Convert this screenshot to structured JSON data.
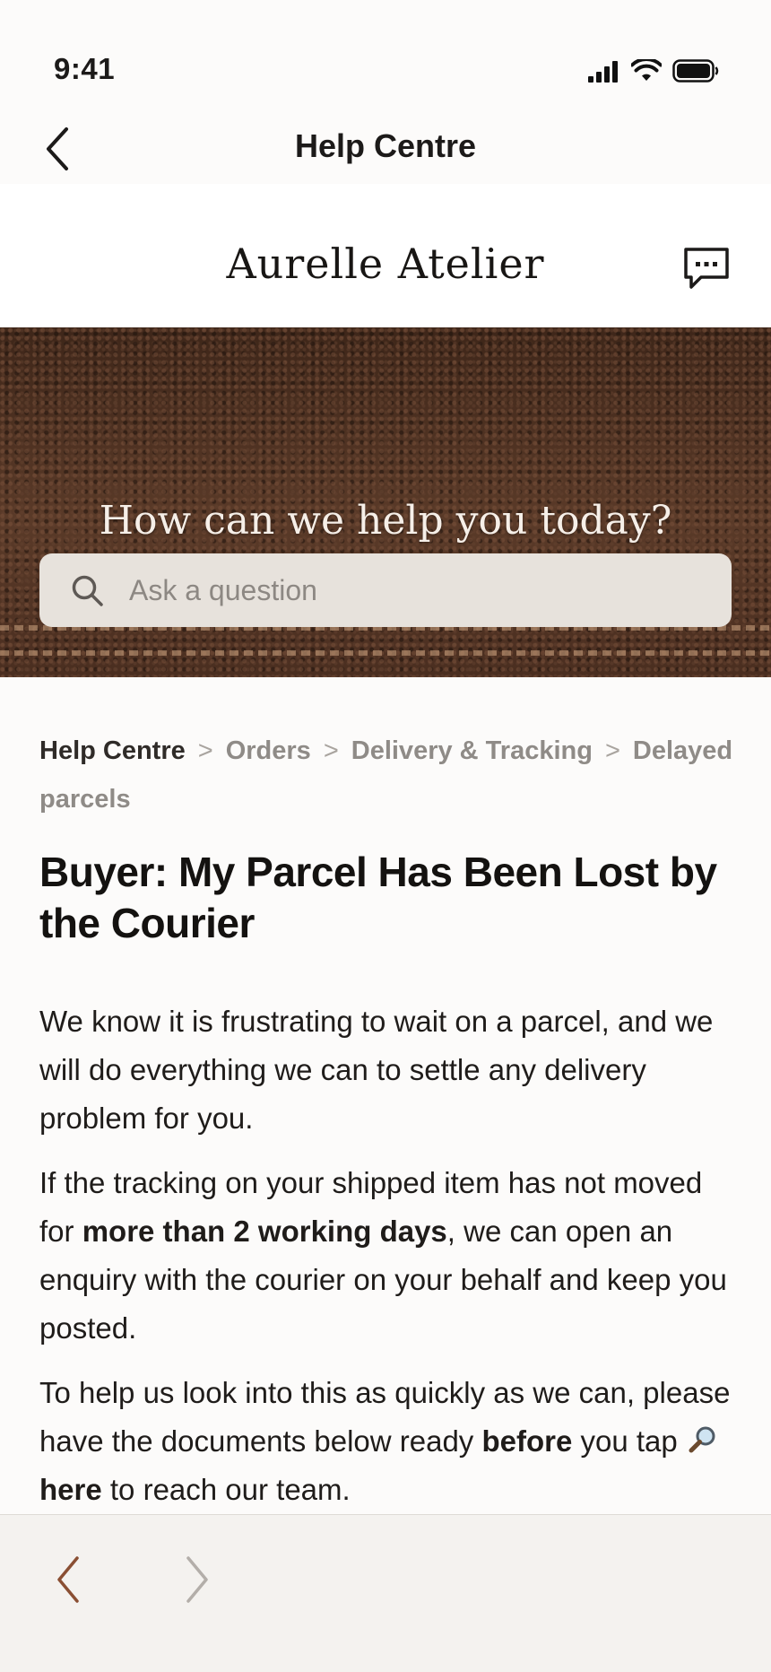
{
  "status_bar": {
    "time": "9:41"
  },
  "nav": {
    "title": "Help Centre",
    "back_icon": "chevron-left-icon"
  },
  "brand": {
    "name": "Aurelle Atelier",
    "chat_icon": "chat-bubble-icon"
  },
  "hero": {
    "heading": "How can we help you today?",
    "search_placeholder": "Ask a question",
    "search_value": ""
  },
  "breadcrumb": [
    "Help Centre",
    "Orders",
    "Delivery & Tracking",
    "Delayed parcels"
  ],
  "breadcrumb_separator": ">",
  "article": {
    "title": "Buyer: My Parcel Has Been Lost by the Courier",
    "para1": "We know it is frustrating to wait on a parcel, and we will do everything we can to settle any delivery problem for you.",
    "para2_a": "If the tracking on your shipped item has not moved for ",
    "para2_bold": "more than 2 working days",
    "para2_b": ", we can open an enquiry with the courier on your behalf and keep you posted.",
    "para3_a": "To help us look into this as quickly as we can, please have the documents below ready ",
    "para3_bold": "before",
    "para3_b": " you tap ",
    "para3_link": "here",
    "para3_c": " to reach our team."
  },
  "toolbar": {
    "back_icon": "chevron-left-icon",
    "forward_icon": "chevron-right-icon"
  },
  "colors": {
    "accent": "#8a4f33",
    "background": "#fcfbfa",
    "toolbar_bg": "#f4f2ef",
    "search_bg": "#e7e2dc",
    "hero_leather": "#4b3022"
  }
}
